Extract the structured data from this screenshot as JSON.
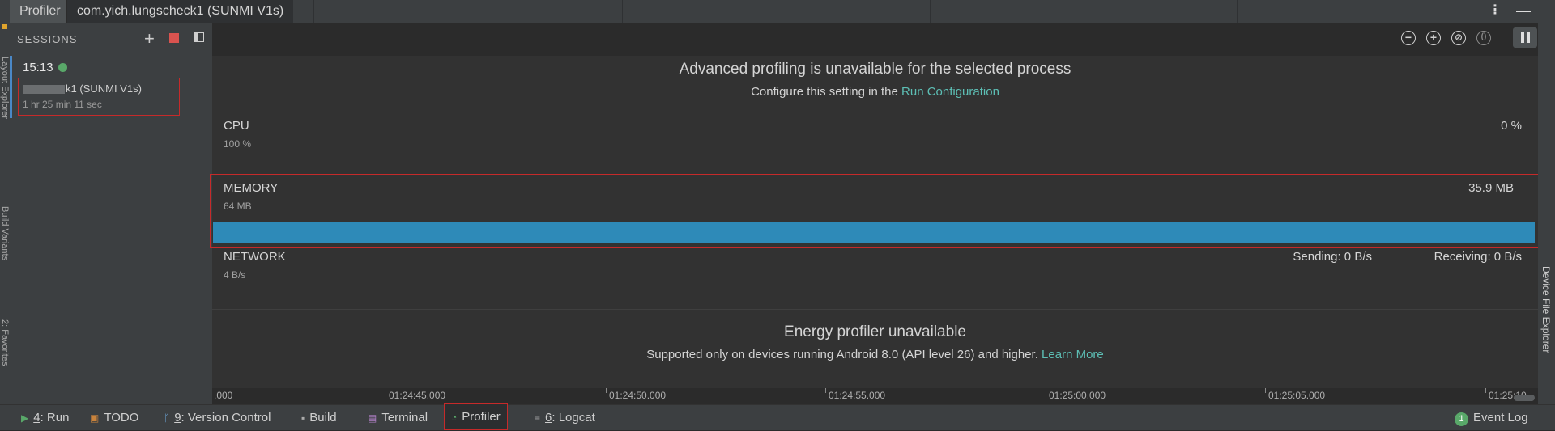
{
  "tabs": {
    "profiler": "Profiler",
    "process": "com.yich.lungscheck1 (SUNMI V1s)"
  },
  "left_strip": {
    "layout_explorer": "Layout Explorer",
    "build_variants": "Build Variants",
    "favorites": "2: Favorites"
  },
  "sessions": {
    "title": "SESSIONS",
    "add_symbol": "+",
    "item": {
      "time": "15:13",
      "name_suffix": "k1 (SUNMI V1s)",
      "duration": "1 hr 25 min 11 sec"
    }
  },
  "toolbar": {
    "zoom_out": "−",
    "zoom_in": "+",
    "reset_zoom": "⊘",
    "attach": "()"
  },
  "advanced": {
    "title": "Advanced profiling is unavailable for the selected process",
    "subtitle_prefix": "Configure this setting in the ",
    "subtitle_link": "Run Configuration"
  },
  "cpu": {
    "label": "CPU",
    "scale": "100 %",
    "value": "0 %"
  },
  "memory": {
    "label": "MEMORY",
    "scale": "64 MB",
    "value": "35.9 MB"
  },
  "network": {
    "label": "NETWORK",
    "scale": "4 B/s",
    "sending": "Sending: 0 B/s",
    "receiving": "Receiving: 0 B/s"
  },
  "energy": {
    "title": "Energy profiler unavailable",
    "subtitle_prefix": "Supported only on devices running Android 8.0 (API level 26) and higher. ",
    "subtitle_link": "Learn More"
  },
  "time_axis": [
    ".000",
    "01:24:45.000",
    "01:24:50.000",
    "01:24:55.000",
    "01:25:00.000",
    "01:25:05.000",
    "01:25:10"
  ],
  "right_strip": {
    "device_file_explorer": "Device File Explorer"
  },
  "bottom": {
    "run_num": "4",
    "run_label": ": Run",
    "todo": "TODO",
    "vc_num": "9",
    "vc_label": ": Version Control",
    "build": "Build",
    "terminal": "Terminal",
    "profiler": "Profiler",
    "logcat_num": "6",
    "logcat_label": ": Logcat",
    "event_count": "1",
    "event_log": "Event Log"
  },
  "colors": {
    "accent_red": "#c62a2a",
    "memory_bar": "#2e8ab8",
    "link": "#5dbfb5",
    "status_green": "#59a869"
  }
}
